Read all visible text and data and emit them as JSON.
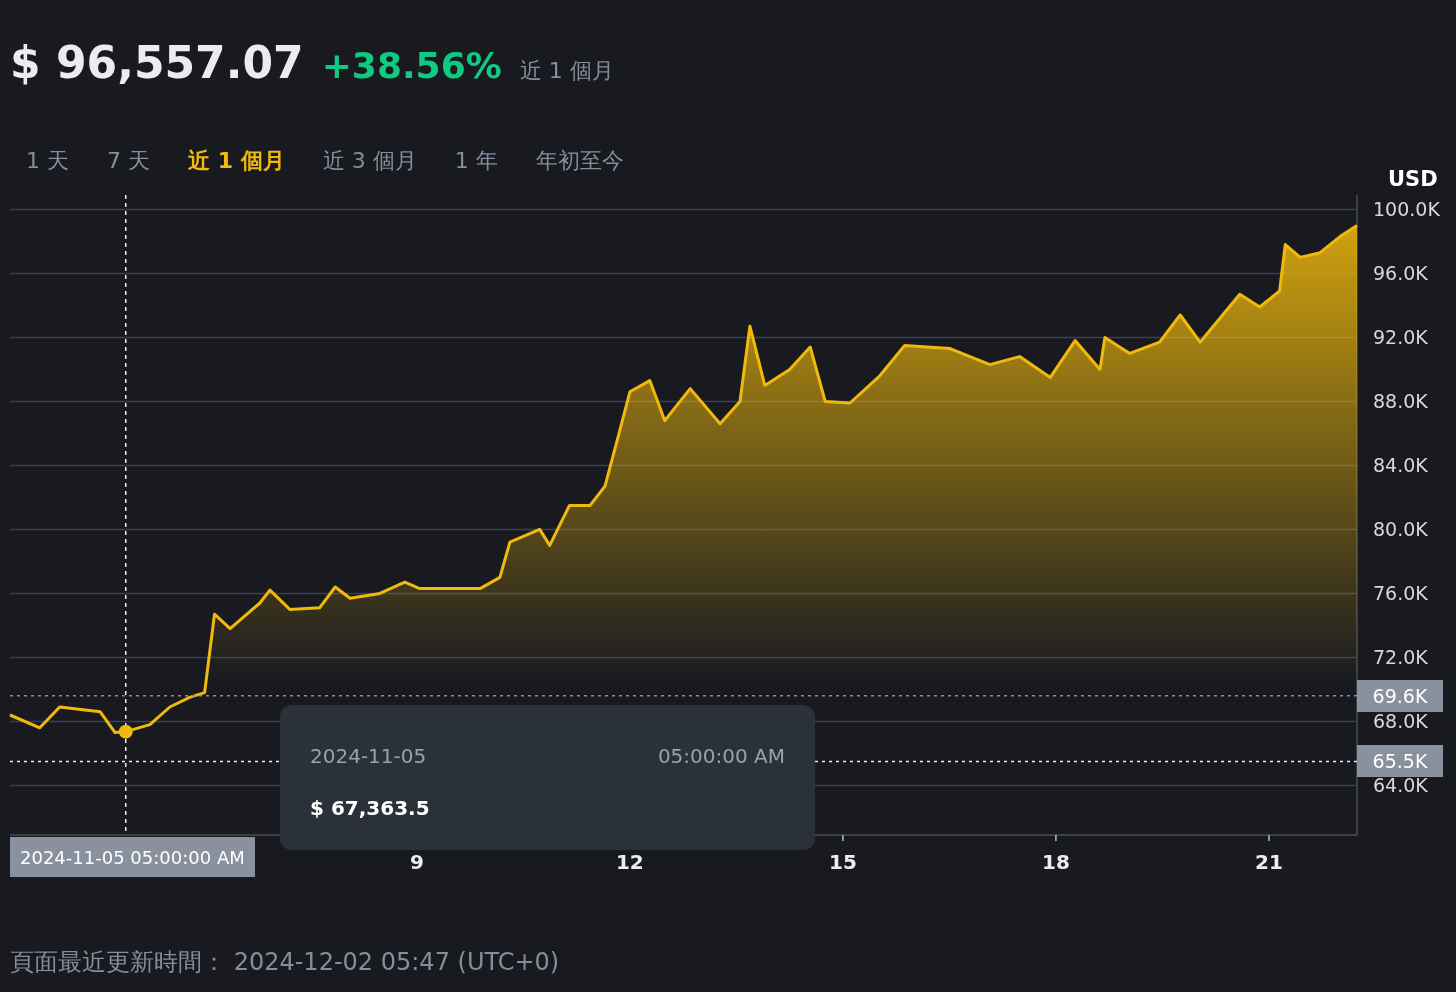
{
  "header": {
    "price": "$ 96,557.07",
    "change": "+38.56%",
    "period": "近 1 個月"
  },
  "tabs": [
    {
      "label": "1 天",
      "selected": false
    },
    {
      "label": "7 天",
      "selected": false
    },
    {
      "label": "近 1 個月",
      "selected": true
    },
    {
      "label": "近 3 個月",
      "selected": false
    },
    {
      "label": "1 年",
      "selected": false
    },
    {
      "label": "年初至今",
      "selected": false
    }
  ],
  "chart": {
    "tooltip": {
      "date": "2024-11-05",
      "time": "05:00:00 AM",
      "price": "$ 67,363.5"
    },
    "chart_data": {
      "type": "area",
      "x": [
        3.27,
        3.69,
        3.97,
        4.54,
        4.75,
        4.9,
        5.24,
        5.52,
        5.8,
        6.01,
        6.15,
        6.37,
        6.79,
        6.93,
        7.21,
        7.63,
        7.85,
        8.06,
        8.48,
        8.83,
        9.04,
        9.89,
        10.17,
        10.31,
        10.73,
        10.87,
        11.15,
        11.44,
        11.65,
        11.86,
        12.0,
        12.28,
        12.49,
        12.85,
        13.27,
        13.55,
        13.69,
        13.9,
        14.25,
        14.54,
        14.75,
        15.1,
        15.52,
        15.87,
        16.51,
        17.07,
        17.49,
        17.92,
        18.27,
        18.62,
        18.69,
        19.04,
        19.46,
        19.75,
        20.03,
        20.59,
        20.87,
        21.15,
        21.23,
        21.44,
        21.72,
        22.0,
        22.24
      ],
      "ylabel": "USD",
      "series": [
        {
          "color": "#f0b90b",
          "values": [
            68.4,
            67.6,
            68.9,
            68.6,
            67.3,
            67.36,
            67.8,
            68.9,
            69.5,
            69.8,
            74.7,
            73.8,
            75.4,
            76.2,
            75.0,
            75.1,
            76.4,
            75.7,
            76.0,
            76.7,
            76.3,
            76.3,
            77.0,
            79.2,
            80.0,
            79.0,
            81.5,
            81.5,
            82.7,
            86.2,
            88.6,
            89.3,
            86.8,
            88.8,
            86.6,
            88.0,
            92.7,
            89.0,
            90.0,
            91.4,
            88.0,
            87.9,
            89.6,
            91.5,
            91.3,
            90.3,
            90.8,
            89.5,
            91.8,
            90.0,
            92.0,
            91.0,
            91.7,
            93.4,
            91.7,
            94.7,
            93.9,
            94.9,
            97.8,
            97.0,
            97.3,
            98.3,
            99.0
          ]
        }
      ],
      "xlim": [
        3.27,
        22.24
      ],
      "ylim": [
        60.9,
        100.9
      ],
      "xticks": [
        9,
        12,
        15,
        18,
        21
      ],
      "yticks": [
        {
          "value": 64,
          "label": "64.0K"
        },
        {
          "value": 68,
          "label": "68.0K"
        },
        {
          "value": 72,
          "label": "72.0K"
        },
        {
          "value": 76,
          "label": "76.0K"
        },
        {
          "value": 80,
          "label": "80.0K"
        },
        {
          "value": 84,
          "label": "84.0K"
        },
        {
          "value": 88,
          "label": "88.0K"
        },
        {
          "value": 92,
          "label": "92.0K"
        },
        {
          "value": 96,
          "label": "96.0K"
        },
        {
          "value": 100,
          "label": "100.0K"
        }
      ],
      "grid": true,
      "ref_lines": [
        {
          "axis": "x",
          "value": 4.9,
          "label": "2024-11-05 05:00:00 AM",
          "color": "#eaecef"
        },
        {
          "axis": "y",
          "value": 69.6,
          "label": "69.6K",
          "color": "#848e9c"
        },
        {
          "axis": "y",
          "value": 65.5,
          "label": "65.5K",
          "color": "#eaecef"
        }
      ]
    }
  },
  "footer": {
    "updated": "頁面最近更新時間： 2024-12-02 05:47 (UTC+0)"
  }
}
